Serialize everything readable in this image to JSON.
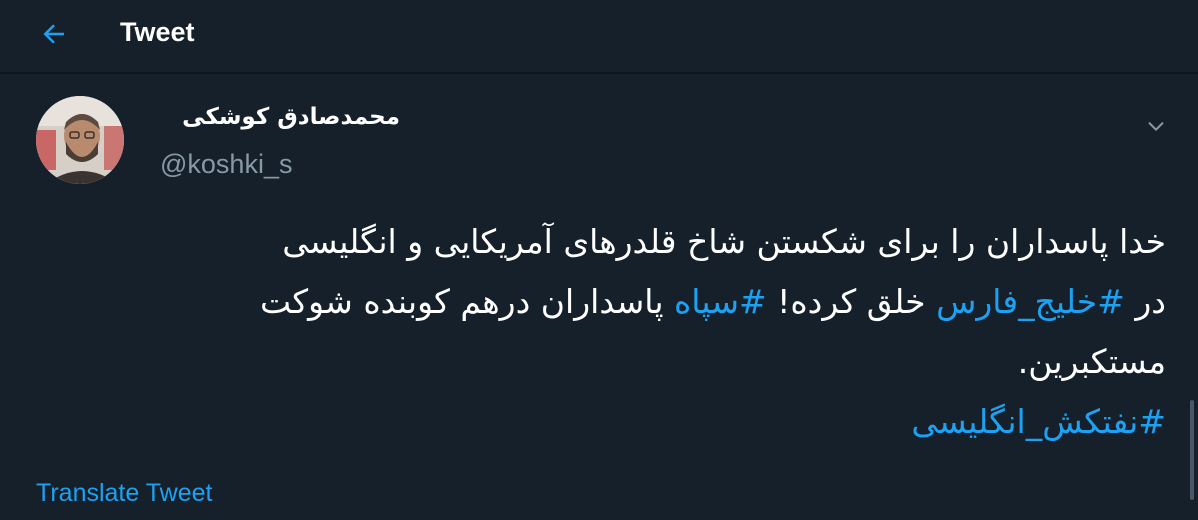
{
  "header": {
    "title": "Tweet",
    "back_icon": "arrow-left-icon"
  },
  "author": {
    "display_name": "محمدصادق کوشکی",
    "handle": "@koshki_s",
    "avatar": "user-avatar-photo"
  },
  "tweet": {
    "line1": "خدا پاسداران را برای شکستن شاخ قلدرهای آمریکایی و انگلیسی",
    "line2_before": "در ",
    "hashtag1": "#خلیج_فارس",
    "line2_mid": " خلق کرده! ",
    "hashtag2": "#سپاه",
    "line2_after": " پاسداران درهم کوبنده شوکت",
    "line3": "مستکبرین.",
    "hashtag3": "#نفتکش_انگلیسی"
  },
  "translate_label": "Translate Tweet",
  "colors": {
    "background": "#15202b",
    "accent": "#1da1f2",
    "secondary_text": "#8899a6"
  }
}
